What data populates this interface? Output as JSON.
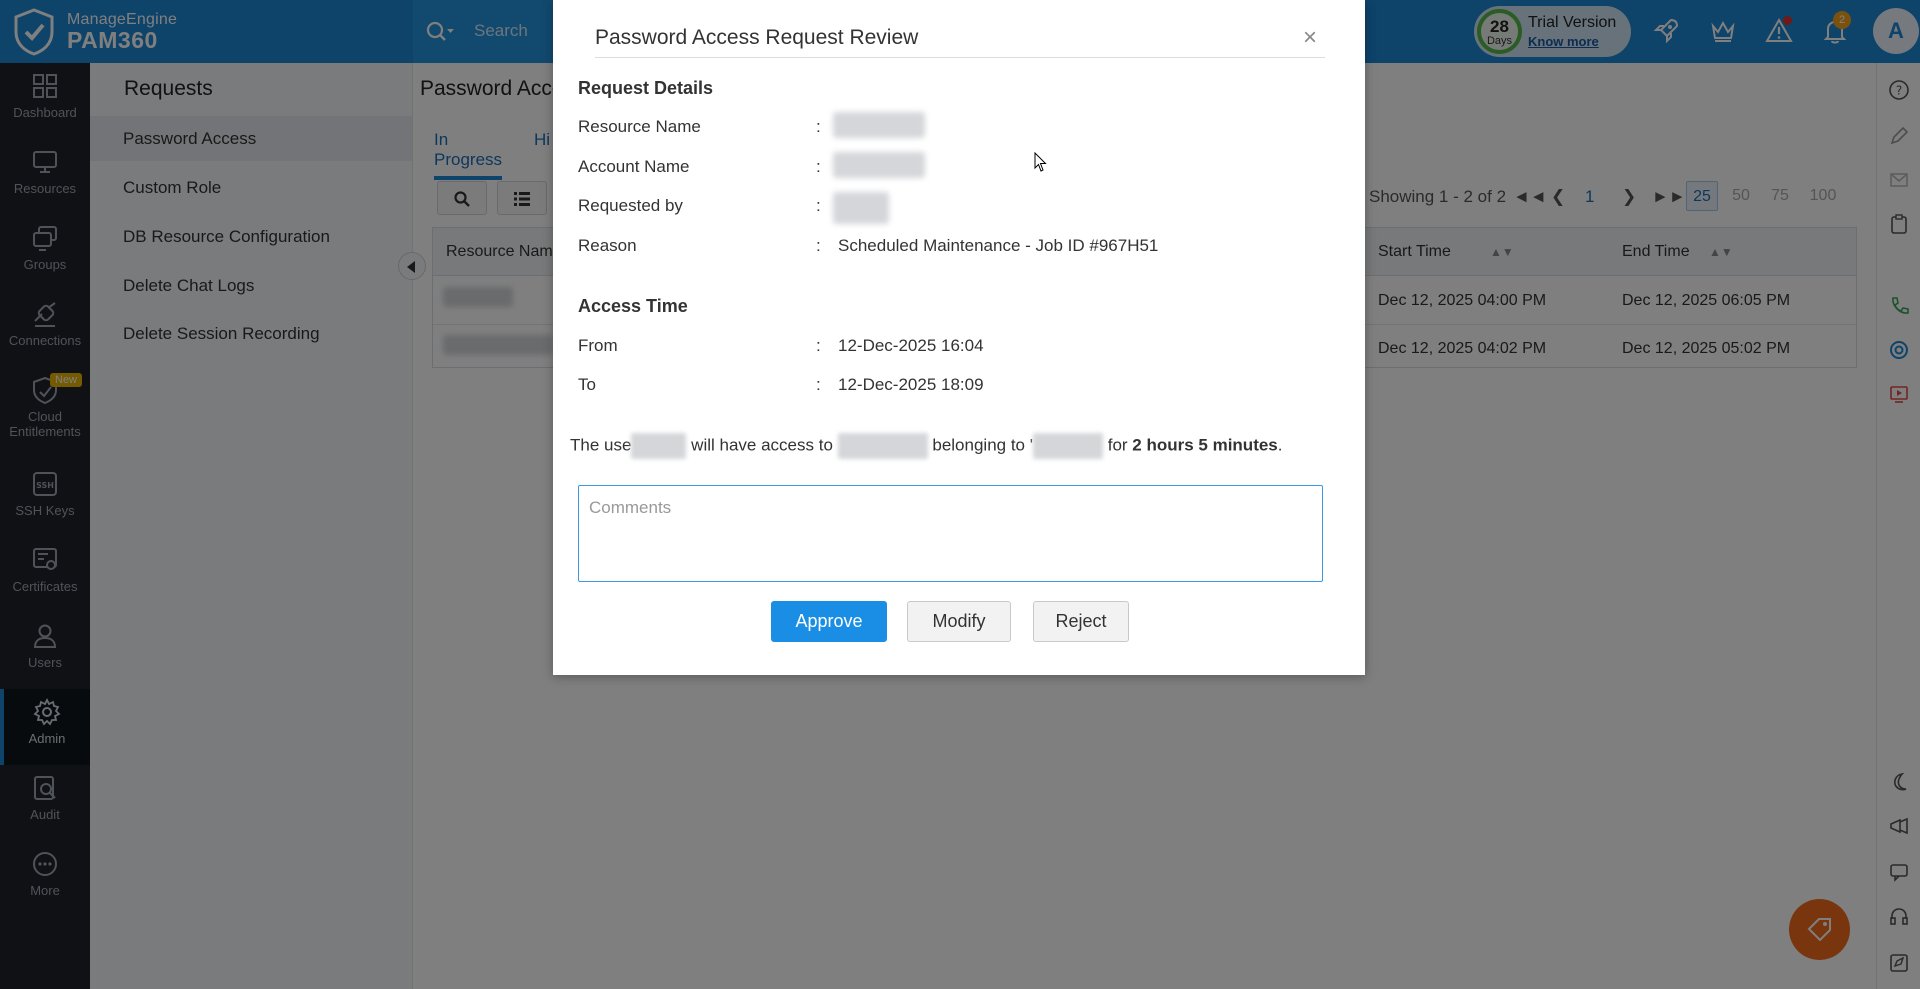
{
  "brand": {
    "top": "ManageEngine",
    "bottom": "PAM360"
  },
  "search": {
    "placeholder": "Search"
  },
  "trial": {
    "days_number": "28",
    "days_label": "Days",
    "title": "Trial Version",
    "link": "Know more"
  },
  "notifications": {
    "count": "2"
  },
  "user": {
    "avatar_letter": "A"
  },
  "leftnav": [
    {
      "label": "Dashboard",
      "icon": "dashboard-icon"
    },
    {
      "label": "Resources",
      "icon": "monitor-icon"
    },
    {
      "label": "Groups",
      "icon": "groups-icon"
    },
    {
      "label": "Connections",
      "icon": "connections-icon"
    },
    {
      "label": "Cloud Entitlements",
      "icon": "cloud-shield-icon",
      "badge": "New"
    },
    {
      "label": "SSH Keys",
      "icon": "ssh-icon"
    },
    {
      "label": "Certificates",
      "icon": "certificate-icon"
    },
    {
      "label": "Users",
      "icon": "user-icon"
    },
    {
      "label": "Admin",
      "icon": "gear-icon",
      "active": true
    },
    {
      "label": "Audit",
      "icon": "audit-icon"
    },
    {
      "label": "More",
      "icon": "more-icon"
    }
  ],
  "subnav": {
    "title": "Requests",
    "items": [
      {
        "label": "Password Access",
        "active": true
      },
      {
        "label": "Custom Role"
      },
      {
        "label": "DB Resource Configuration"
      },
      {
        "label": "Delete Chat Logs"
      },
      {
        "label": "Delete Session Recording"
      }
    ]
  },
  "main": {
    "title": "Password Acce",
    "tabs": [
      {
        "label": "In Progress",
        "active": true
      },
      {
        "label": "Hi"
      }
    ],
    "pager": {
      "showing": "Showing 1 - 2 of 2",
      "current_page": "1",
      "page_sizes": [
        "25",
        "50",
        "75",
        "100"
      ],
      "selected_size": "25"
    },
    "table": {
      "headers": {
        "resource_name": "Resource Nam",
        "start_time": "Start Time",
        "end_time": "End Time"
      },
      "rows": [
        {
          "start": "Dec 12, 2025 04:00 PM",
          "end": "Dec 12, 2025 06:05 PM"
        },
        {
          "start": "Dec 12, 2025 04:02 PM",
          "end": "Dec 12, 2025 05:02 PM"
        }
      ]
    }
  },
  "modal": {
    "title": "Password Access Request Review",
    "close": "×",
    "request_details": {
      "heading": "Request Details",
      "resource_label": "Resource Name",
      "account_label": "Account Name",
      "requested_by_label": "Requested by",
      "reason_label": "Reason",
      "reason_value": "Scheduled Maintenance - Job ID #967H51"
    },
    "access_time": {
      "heading": "Access Time",
      "from_label": "From",
      "from_value": "12-Dec-2025 16:04",
      "to_label": "To",
      "to_value": "12-Dec-2025 18:09"
    },
    "colon": ":",
    "summary": {
      "part1": "The use",
      "part2": "will have access to",
      "part3": "belonging to '",
      "part4": "for ",
      "duration": "2 hours 5 minutes",
      "end": "."
    },
    "comments_placeholder": "Comments",
    "buttons": {
      "approve": "Approve",
      "modify": "Modify",
      "reject": "Reject"
    }
  },
  "colors": {
    "brand_blue": "#1d87d4",
    "approve_blue": "#1a8ee5",
    "nav_dark": "#1e2228",
    "fab_orange": "#f26b1d"
  }
}
